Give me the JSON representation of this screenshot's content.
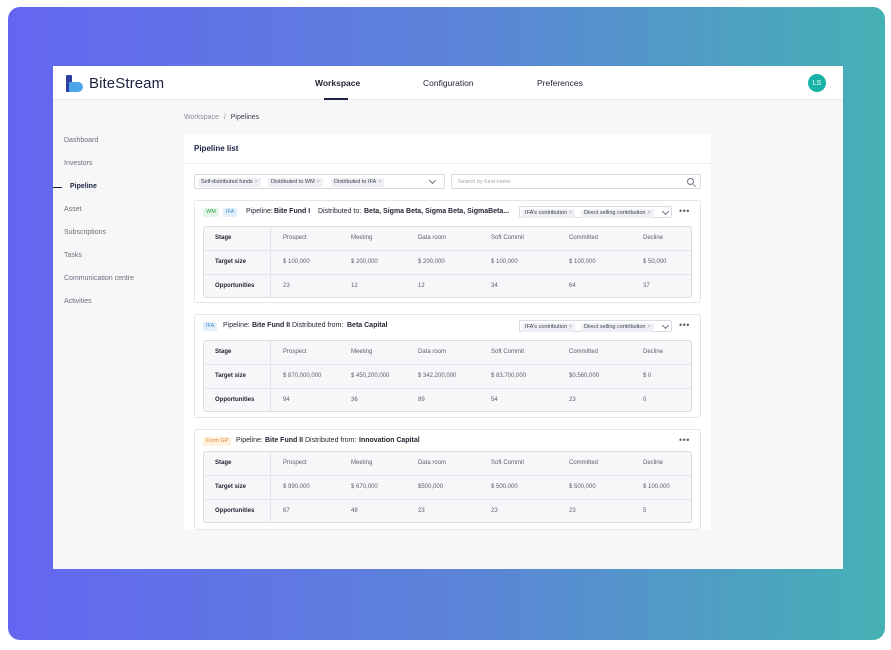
{
  "app": {
    "brand": "BiteStream",
    "avatar_initials": "LS",
    "accent": "#19b3a9",
    "nav": [
      "Workspace",
      "Configuration",
      "Preferences"
    ],
    "active_nav": "Workspace"
  },
  "sidebar": {
    "items": [
      "Dashboard",
      "Investors",
      "Pipeline",
      "Asset",
      "Subscriptions",
      "Tasks",
      "Communication centre",
      "Activities"
    ],
    "active": "Pipeline"
  },
  "breadcrumb": {
    "root": "Workspace",
    "separator": "/",
    "current": "Pipelines"
  },
  "panel": {
    "title": "Pipeline list",
    "filter_chips": [
      "Self-distributed funds",
      "Distributed to WM",
      "Distributed to IFA"
    ],
    "search_placeholder": "Search by fund name"
  },
  "table_labels": {
    "stage": "Stage",
    "target_size": "Target size",
    "opportunities": "Opportunities"
  },
  "stages": [
    "Prospect",
    "Meeting",
    "Data room",
    "Soft Commit",
    "Committed",
    "Decline"
  ],
  "cards": [
    {
      "tags": [
        "WM",
        "IFA"
      ],
      "pipeline_label": "Pipeline:",
      "fund": "Bite Fund I",
      "dist_label": "Distributed to:",
      "dist_value": "Beta, Sigma  Beta, Sigma  Beta, SigmaBeta...",
      "contrib_chips": [
        "IFA's contribution",
        "Direct selling contribution"
      ],
      "target_sizes": [
        "$ 100,000",
        "$ 200,000",
        "$ 200,000",
        "$ 100,000",
        "$ 100,000",
        "$ 50,000"
      ],
      "opportunities": [
        "23",
        "12",
        "12",
        "34",
        "64",
        "37"
      ]
    },
    {
      "tags": [
        "IFA"
      ],
      "pipeline_label": "Pipeline:",
      "fund": "Bite Fund II",
      "dist_label": "Distributed from:",
      "dist_value": "Beta Capital",
      "contrib_chips": [
        "IFA's contribution",
        "Direct selling contribution"
      ],
      "target_sizes": [
        "$ 870,000,000",
        "$ 450,200,000",
        "$ 342,200,000",
        "$ 83,700,000",
        "$0,560,000",
        "$ 0"
      ],
      "opportunities": [
        "94",
        "36",
        "89",
        "54",
        "23",
        "0"
      ]
    },
    {
      "tags": [
        "From GP"
      ],
      "pipeline_label": "Pipeline:",
      "fund": "Bite Fund II",
      "dist_label": "Distributed from:",
      "dist_value": "Innovation Capital",
      "contrib_chips": [],
      "target_sizes": [
        "$ 990,000",
        "$ 670,000",
        "$500,000",
        "$ 500,000",
        "$ 500,000",
        "$ 100,000"
      ],
      "opportunities": [
        "67",
        "48",
        "23",
        "23",
        "23",
        "5"
      ]
    }
  ]
}
